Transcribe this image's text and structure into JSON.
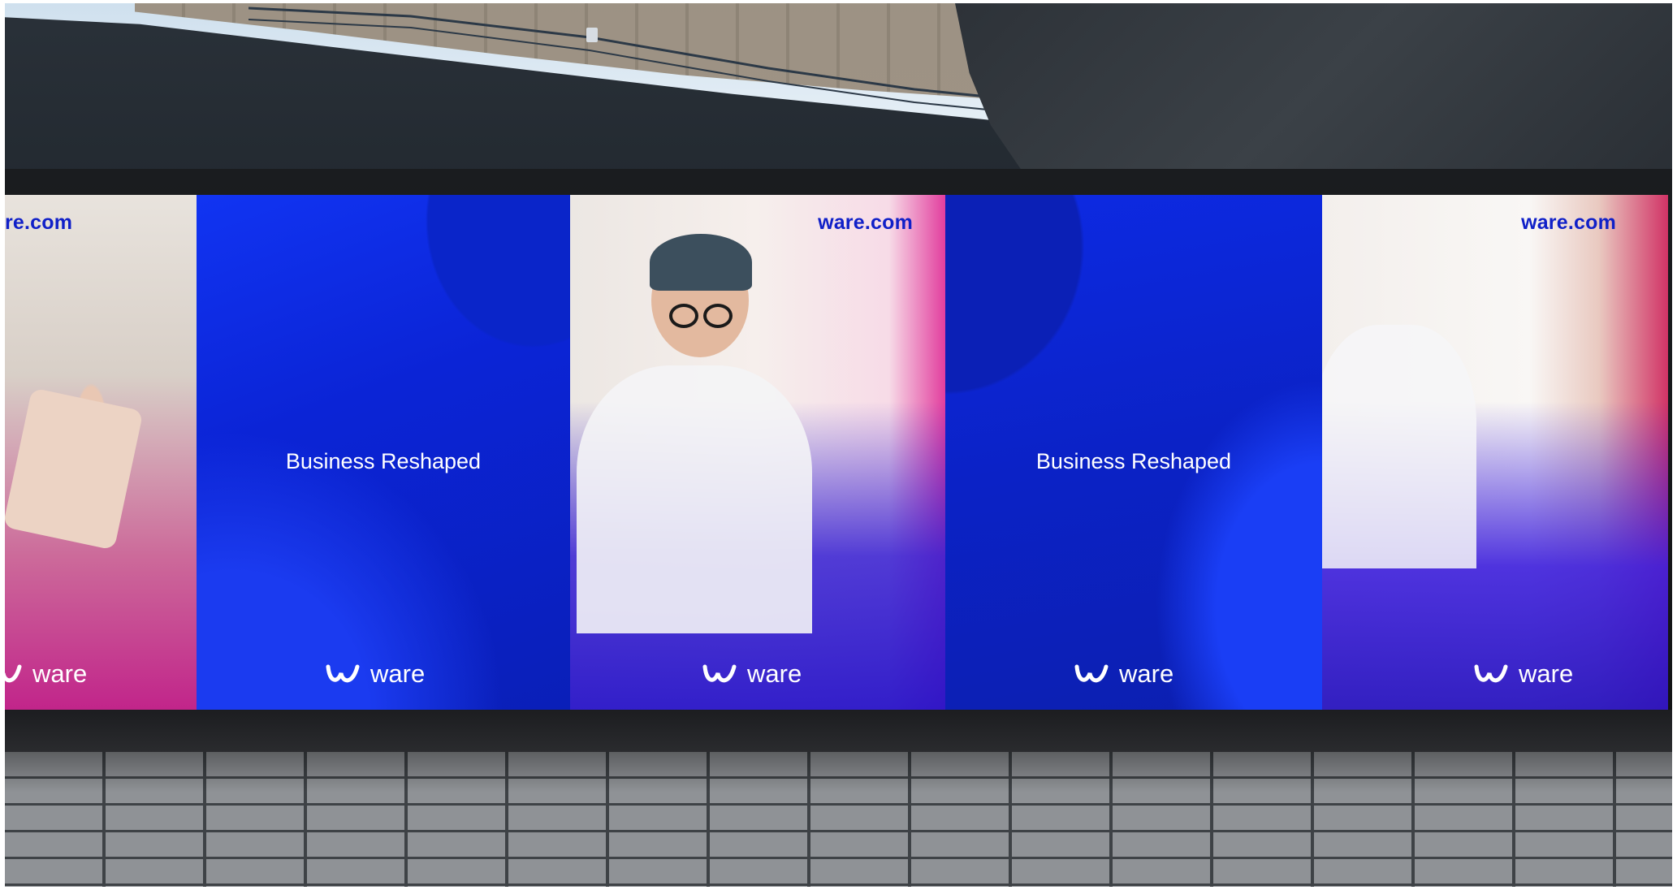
{
  "scene": {
    "panels": [
      {
        "kind": "photo",
        "url_text": "re.com",
        "logo_text": "ware"
      },
      {
        "kind": "blue",
        "headline": "Business Reshaped",
        "logo_text": "ware"
      },
      {
        "kind": "photo",
        "url_text": "ware.com",
        "logo_text": "ware"
      },
      {
        "kind": "blue",
        "headline": "Business Reshaped",
        "logo_text": "ware"
      },
      {
        "kind": "photo",
        "url_text": "ware.com",
        "logo_text": "ware"
      }
    ]
  },
  "colors": {
    "brand_blue": "#0b24d6",
    "url_blue": "#1020c8",
    "accent_magenta": "#c1248a"
  },
  "icons": {
    "logo_mark": "ware-logo-icon"
  }
}
